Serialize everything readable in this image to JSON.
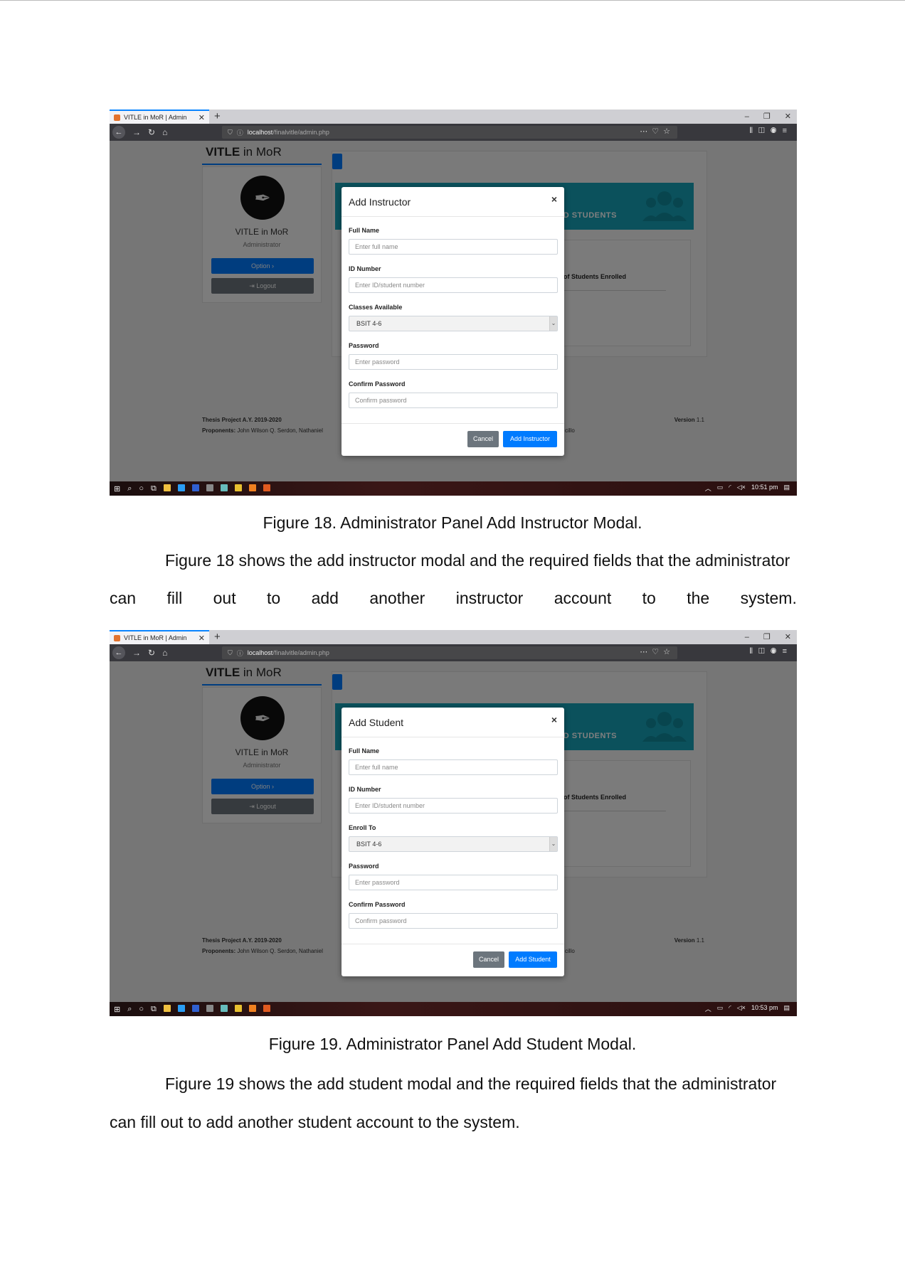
{
  "browser": {
    "tab_title": "VITLE in MoR | Admin",
    "url_host": "localhost",
    "url_path": "/finalvitle/admin.php"
  },
  "app": {
    "brand_bold": "VITLE",
    "brand_rest": " in MoR",
    "profile_name": "VITLE in MoR",
    "profile_role": "Administrator",
    "option_label": "Option ›",
    "logout_label": "⇥ Logout",
    "banner_text": "ED STUDENTS",
    "enrolled_text": "o. of Students Enrolled",
    "footer_line1": "Thesis Project A.Y. 2019-2020",
    "footer_proponents_label": "Proponents:",
    "footer_proponents": " John Wilson Q. Serdon, Nathaniel",
    "footer_tail": "cillo",
    "version_label": "Version",
    "version_num": " 1.1"
  },
  "figure18": {
    "modal_title": "Add Instructor",
    "close": "×",
    "full_name_label": "Full Name",
    "full_name_placeholder": "Enter full name",
    "id_label": "ID Number",
    "id_placeholder": "Enter ID/student number",
    "select_label": "Classes Available",
    "select_value": "BSIT 4-6",
    "password_label": "Password",
    "password_placeholder": "Enter password",
    "confirm_label": "Confirm Password",
    "confirm_placeholder": "Confirm password",
    "cancel_label": "Cancel",
    "submit_label": "Add Instructor",
    "time": "10:51 pm",
    "caption": "Figure 18. Administrator Panel Add Instructor Modal.",
    "para_line1": "Figure 18 shows the add instructor modal and the required fields that the administrator",
    "para_line2_words": [
      "can",
      "fill",
      "out",
      "to",
      "add",
      "another",
      "instructor",
      "account",
      "to",
      "the",
      "system."
    ]
  },
  "figure19": {
    "modal_title": "Add Student",
    "close": "×",
    "full_name_label": "Full Name",
    "full_name_placeholder": "Enter full name",
    "id_label": "ID Number",
    "id_placeholder": "Enter ID/student number",
    "select_label": "Enroll To",
    "select_value": "BSIT 4-6",
    "password_label": "Password",
    "password_placeholder": "Enter password",
    "confirm_label": "Confirm Password",
    "confirm_placeholder": "Confirm password",
    "cancel_label": "Cancel",
    "submit_label": "Add Student",
    "time": "10:53 pm",
    "caption": "Figure 19. Administrator Panel Add Student Modal.",
    "para_line1": "Figure 19 shows the add student modal and the required fields that the administrator",
    "para_line2": "can fill out to add another student account to the system."
  }
}
